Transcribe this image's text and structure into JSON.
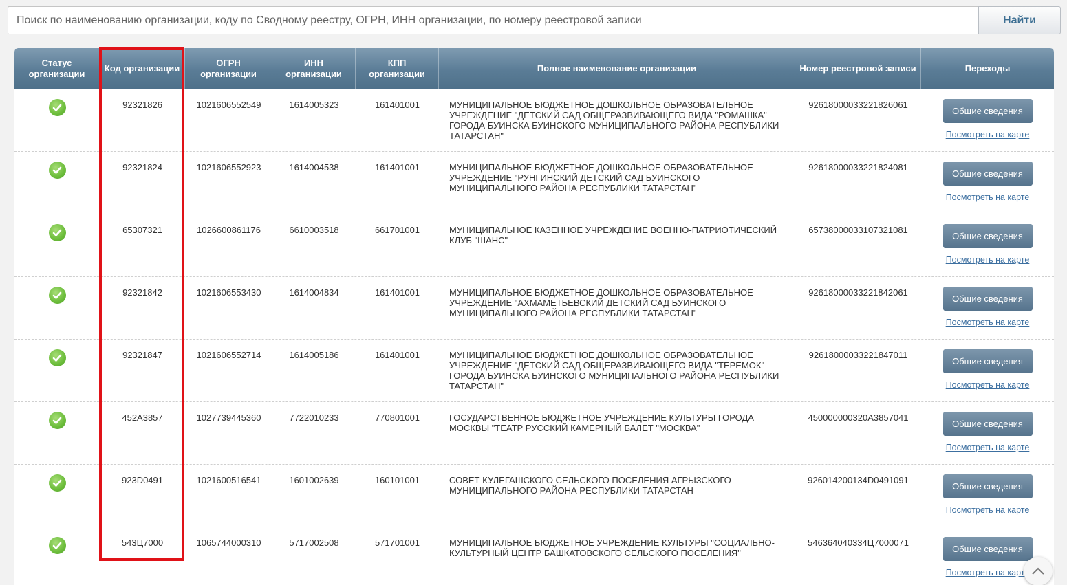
{
  "search": {
    "placeholder": "Поиск по наименованию организации, коду по Сводному реестру, ОГРН, ИНН организации, по номеру реестровой записи",
    "button_label": "Найти"
  },
  "table": {
    "headers": [
      "Статус организации",
      "Код организации",
      "ОГРН организации",
      "ИНН организации",
      "КПП организации",
      "Полное наименование организации",
      "Номер реестровой записи",
      "Переходы"
    ],
    "info_button_label": "Общие сведения",
    "map_link_label": "Посмотреть на карте",
    "rows": [
      {
        "code": "92321826",
        "ogrn": "1021606552549",
        "inn": "1614005323",
        "kpp": "161401001",
        "name": "МУНИЦИПАЛЬНОЕ БЮДЖЕТНОЕ ДОШКОЛЬНОЕ ОБРАЗОВАТЕЛЬНОЕ УЧРЕЖДЕНИЕ \"ДЕТСКИЙ САД ОБЩЕРАЗВИВАЮЩЕГО ВИДА \"РОМАШКА\" ГОРОДА БУИНСКА БУИНСКОГО МУНИЦИПАЛЬНОГО РАЙОНА РЕСПУБЛИКИ ТАТАРСТАН\"",
        "reg": "92618000033221826061"
      },
      {
        "code": "92321824",
        "ogrn": "1021606552923",
        "inn": "1614004538",
        "kpp": "161401001",
        "name": "МУНИЦИПАЛЬНОЕ БЮДЖЕТНОЕ ДОШКОЛЬНОЕ ОБРАЗОВАТЕЛЬНОЕ УЧРЕЖДЕНИЕ \"РУНГИНСКИЙ ДЕТСКИЙ САД БУИНСКОГО МУНИЦИПАЛЬНОГО РАЙОНА РЕСПУБЛИКИ ТАТАРСТАН\"",
        "reg": "92618000033221824081"
      },
      {
        "code": "65307321",
        "ogrn": "1026600861176",
        "inn": "6610003518",
        "kpp": "661701001",
        "name": "МУНИЦИПАЛЬНОЕ КАЗЕННОЕ УЧРЕЖДЕНИЕ ВОЕННО-ПАТРИОТИЧЕСКИЙ КЛУБ \"ШАНС\"",
        "reg": "65738000033107321081"
      },
      {
        "code": "92321842",
        "ogrn": "1021606553430",
        "inn": "1614004834",
        "kpp": "161401001",
        "name": "МУНИЦИПАЛЬНОЕ БЮДЖЕТНОЕ ДОШКОЛЬНОЕ ОБРАЗОВАТЕЛЬНОЕ УЧРЕЖДЕНИЕ \"АХМАМЕТЬЕВСКИЙ ДЕТСКИЙ САД БУИНСКОГО МУНИЦИПАЛЬНОГО РАЙОНА РЕСПУБЛИКИ ТАТАРСТАН\"",
        "reg": "92618000033221842061"
      },
      {
        "code": "92321847",
        "ogrn": "1021606552714",
        "inn": "1614005186",
        "kpp": "161401001",
        "name": "МУНИЦИПАЛЬНОЕ БЮДЖЕТНОЕ ДОШКОЛЬНОЕ ОБРАЗОВАТЕЛЬНОЕ УЧРЕЖДЕНИЕ \"ДЕТСКИЙ САД ОБЩЕРАЗВИВАЮЩЕГО ВИДА \"ТЕРЕМОК\" ГОРОДА БУИНСКА БУИНСКОГО МУНИЦИПАЛЬНОГО РАЙОНА РЕСПУБЛИКИ ТАТАРСТАН\"",
        "reg": "92618000033221847011"
      },
      {
        "code": "452А3857",
        "ogrn": "1027739445360",
        "inn": "7722010233",
        "kpp": "770801001",
        "name": "ГОСУДАРСТВЕННОЕ БЮДЖЕТНОЕ УЧРЕЖДЕНИЕ КУЛЬТУРЫ ГОРОДА МОСКВЫ \"ТЕАТР РУССКИЙ КАМЕРНЫЙ БАЛЕТ \"МОСКВА\"",
        "reg": "450000000320А3857041"
      },
      {
        "code": "923D0491",
        "ogrn": "1021600516541",
        "inn": "1601002639",
        "kpp": "160101001",
        "name": "СОВЕТ КУЛЕГАШСКОГО СЕЛЬСКОГО ПОСЕЛЕНИЯ АГРЫЗСКОГО МУНИЦИПАЛЬНОГО РАЙОНА РЕСПУБЛИКИ ТАТАРСТАН",
        "reg": "926014200134D0491091"
      },
      {
        "code": "543Ц7000",
        "ogrn": "1065744000310",
        "inn": "5717002508",
        "kpp": "571701001",
        "name": "МУНИЦИПАЛЬНОЕ БЮДЖЕТНОЕ УЧРЕЖДЕНИЕ КУЛЬТУРЫ \"СОЦИАЛЬНО-КУЛЬТУРНЫЙ ЦЕНТР БАШКАТОВСКОГО СЕЛЬСКОГО ПОСЕЛЕНИЯ\"",
        "reg": "546364040334Ц7000071"
      }
    ]
  },
  "icons": {
    "status": "check-circle-icon",
    "scroll": "chevron-up-icon"
  },
  "colors": {
    "header": "#5a7c96",
    "highlight": "#e01218",
    "status_ok": "#6cbd3b",
    "link": "#3c6fa0"
  }
}
